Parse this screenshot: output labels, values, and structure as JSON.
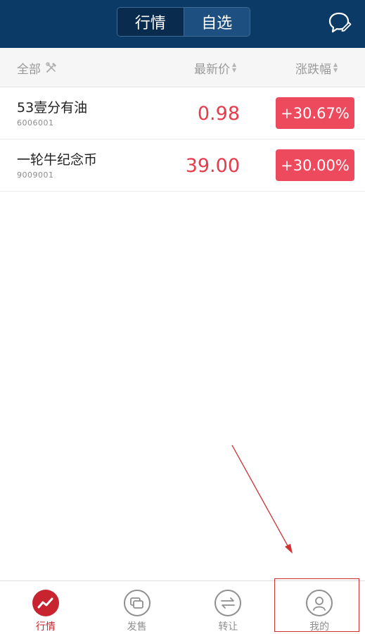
{
  "header": {
    "tabs": [
      {
        "label": "行情",
        "active": true
      },
      {
        "label": "自选",
        "active": false
      }
    ],
    "icon": "chat-edit-icon"
  },
  "columns": {
    "all": "全部",
    "price": "最新价",
    "change": "涨跌幅"
  },
  "rows": [
    {
      "name": "53壹分有油",
      "code": "6006001",
      "price": "0.98",
      "change": "+30.67%"
    },
    {
      "name": "一轮牛纪念币",
      "code": "9009001",
      "price": "39.00",
      "change": "+30.00%"
    }
  ],
  "tabbar": {
    "items": [
      {
        "label": "行情",
        "icon": "trend-chart-icon",
        "active": true
      },
      {
        "label": "发售",
        "icon": "cards-icon",
        "active": false
      },
      {
        "label": "转让",
        "icon": "transfer-arrows-icon",
        "active": false
      },
      {
        "label": "我的",
        "icon": "user-icon",
        "active": false
      }
    ]
  },
  "colors": {
    "header_bg": "#0b3a67",
    "price_red": "#e63b4c",
    "badge_red": "#ee4a5d",
    "active_tab": "#c8242f",
    "annotation": "#cc3333"
  }
}
